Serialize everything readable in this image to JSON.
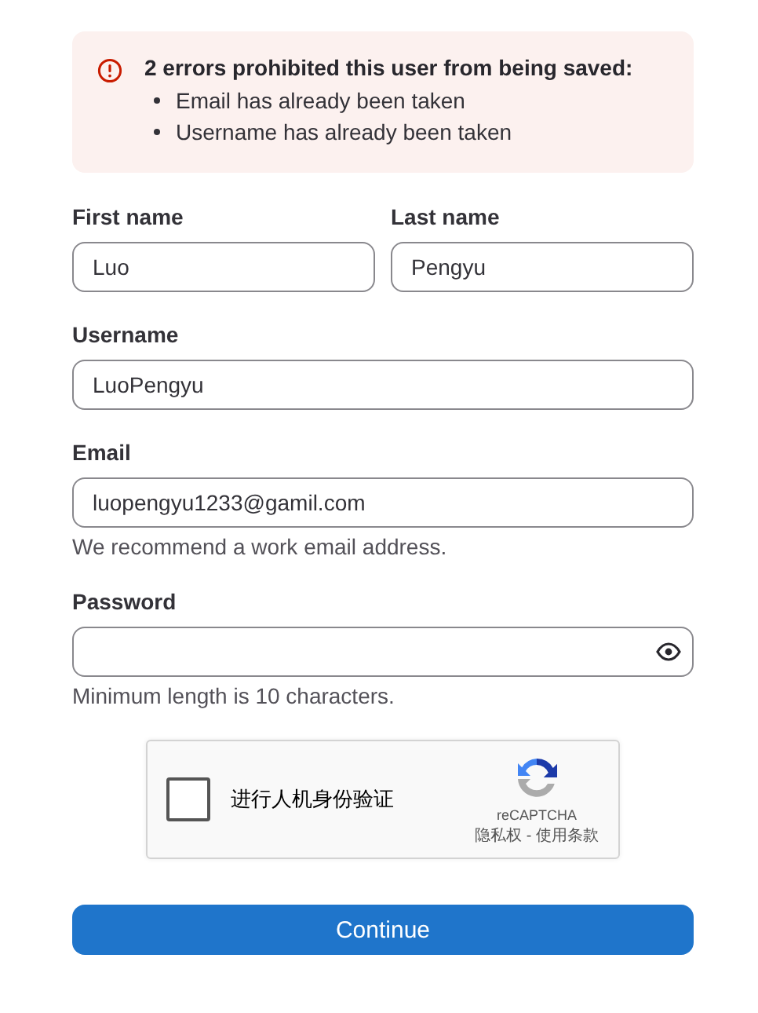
{
  "error_alert": {
    "title": "2 errors prohibited this user from being saved:",
    "messages": [
      "Email has already been taken",
      "Username has already been taken"
    ]
  },
  "name_fields": [
    {
      "label": "First name",
      "value": "Luo",
      "kind": "text"
    },
    {
      "label": "Last name",
      "value": "Pengyu",
      "kind": "text"
    }
  ],
  "fields": [
    {
      "label": "Username",
      "value": "LuoPengyu",
      "kind": "text"
    },
    {
      "label": "Email",
      "value": "luopengyu1233@gamil.com",
      "kind": "text",
      "help": "We recommend a work email address."
    },
    {
      "label": "Password",
      "kind": "password",
      "help": "Minimum length is 10 characters."
    }
  ],
  "captcha": {
    "checked": false,
    "label": "进行人机身份验证",
    "brand": "reCAPTCHA",
    "links": "隐私权 - 使用条款"
  },
  "submit": {
    "label": "Continue"
  }
}
